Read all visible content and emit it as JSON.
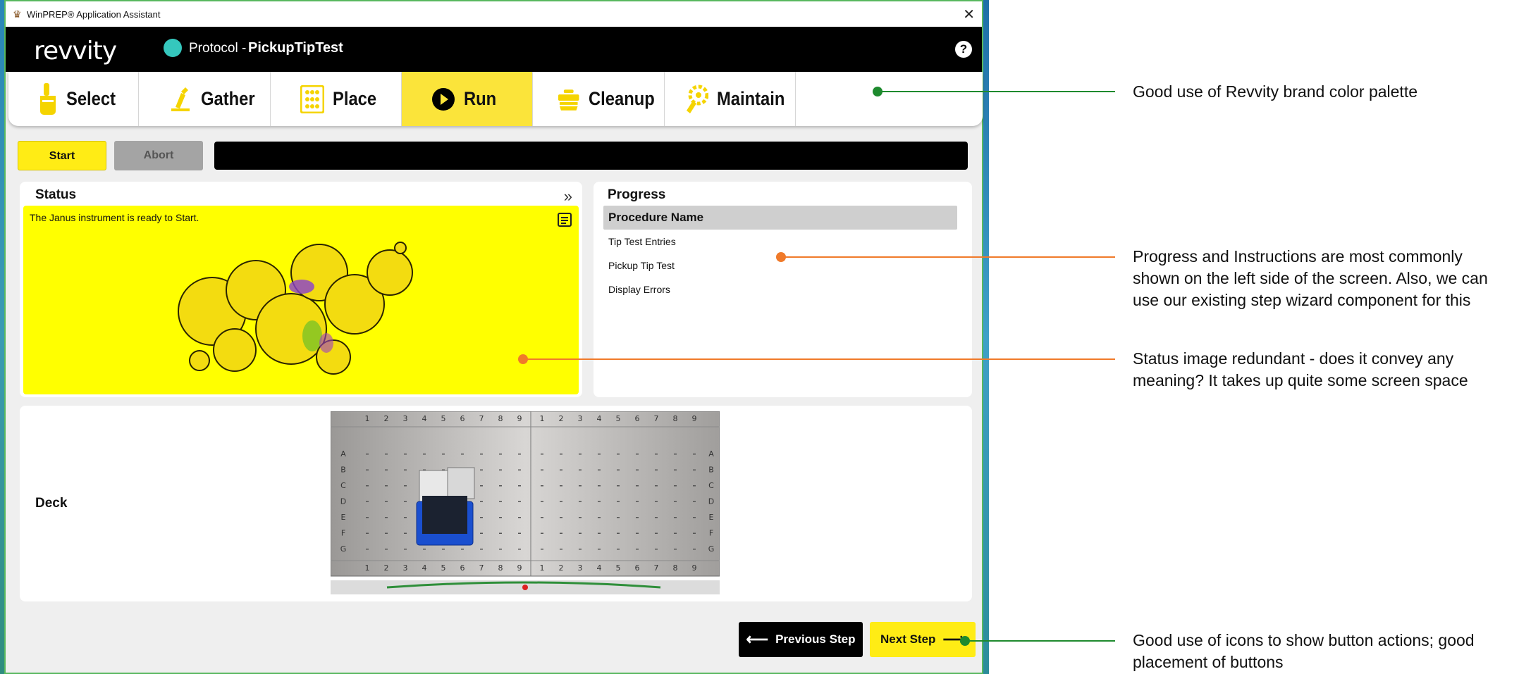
{
  "window": {
    "title": "WinPREP® Application Assistant",
    "close_glyph": "✕"
  },
  "header": {
    "brand": "revvity",
    "protocol_label": "Protocol -",
    "protocol_name": "PickupTipTest",
    "help_glyph": "?",
    "protocol_dot_color": "#35c7bd"
  },
  "tabs": [
    {
      "label": "Select",
      "icon": "hand-pointer-icon",
      "active": false
    },
    {
      "label": "Gather",
      "icon": "microscope-icon",
      "active": false
    },
    {
      "label": "Place",
      "icon": "plate-grid-icon",
      "active": false
    },
    {
      "label": "Run",
      "icon": "play-circle-icon",
      "active": true
    },
    {
      "label": "Cleanup",
      "icon": "cleanup-icon",
      "active": false
    },
    {
      "label": "Maintain",
      "icon": "wrench-gear-icon",
      "active": false
    }
  ],
  "controls": {
    "start_label": "Start",
    "abort_label": "Abort"
  },
  "status": {
    "title": "Status",
    "expand_glyph": "»",
    "message": "The Janus instrument is ready to Start."
  },
  "progress": {
    "title": "Progress",
    "items": [
      "Procedure Name",
      "Tip Test Entries",
      "Pickup Tip Test",
      "Display Errors"
    ],
    "current_index": 0
  },
  "deck": {
    "label": "Deck",
    "column_labels": [
      "1",
      "2",
      "3",
      "4",
      "5",
      "6",
      "7",
      "8",
      "9",
      "1",
      "2",
      "3",
      "4",
      "5",
      "6",
      "7",
      "8",
      "9"
    ],
    "row_labels": [
      "A",
      "B",
      "C",
      "D",
      "E",
      "F",
      "G"
    ]
  },
  "navigation": {
    "previous_label": "Previous Step",
    "next_label": "Next Step"
  },
  "annotations": [
    {
      "text": "Good use of Revvity brand color palette",
      "color": "#1e8a2e"
    },
    {
      "text": "Progress and Instructions are most commonly shown on the left side of the screen. Also, we can use our existing step wizard component for this",
      "color": "#f07a2a"
    },
    {
      "text": "Status image redundant - does it convey any meaning? It takes up quite some screen space",
      "color": "#f07a2a"
    },
    {
      "text": "Good use of icons to show button actions; good placement of buttons",
      "color": "#1e8a2e"
    }
  ],
  "colors": {
    "brand_yellow": "#ffec15",
    "tab_active": "#fbe43a",
    "header": "#000000"
  }
}
